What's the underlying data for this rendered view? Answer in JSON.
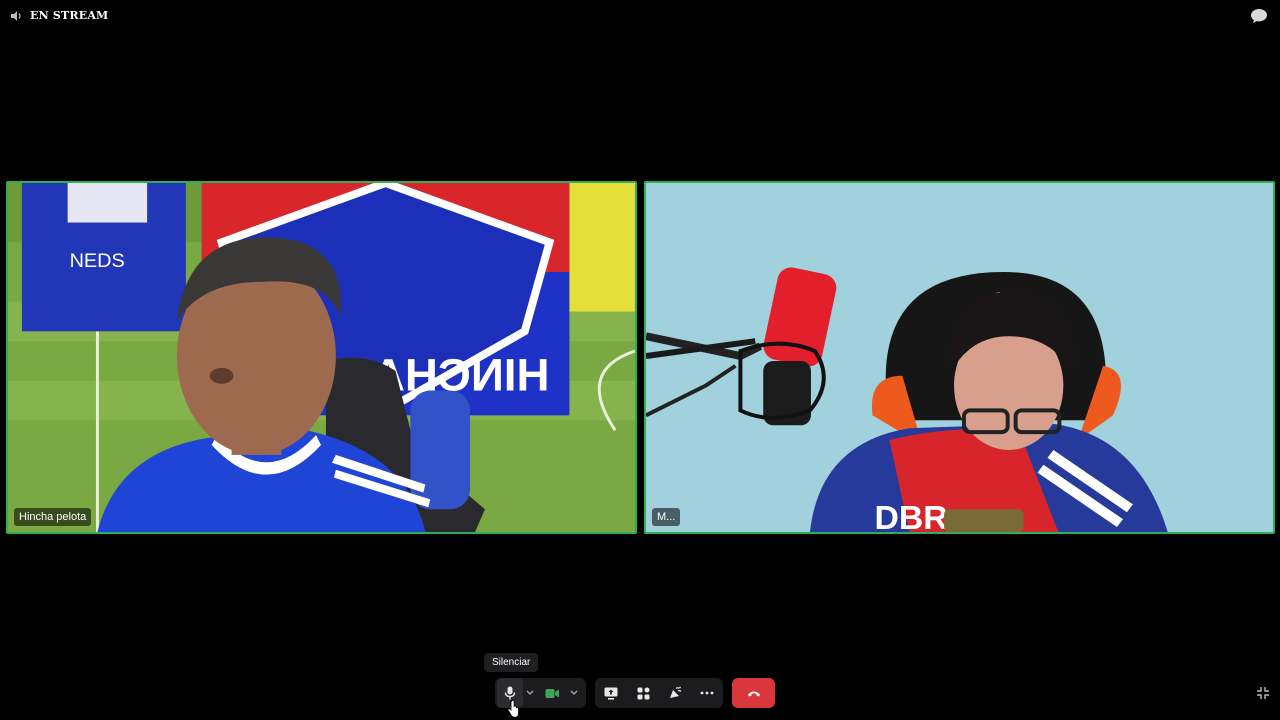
{
  "header": {
    "stream_label": "EN STREAM"
  },
  "participants": [
    {
      "name": "Hincha pelota"
    },
    {
      "name": "M..."
    }
  ],
  "controls": {
    "mute_tooltip": "Silenciar"
  },
  "colors": {
    "speaking_border": "#2fae55",
    "leave_button": "#da373c",
    "toolbar_bg": "#1c1c1f",
    "video_icon": "#3ba55d"
  },
  "icons": [
    "speaker-icon",
    "chat-icon",
    "microphone-icon",
    "chevron-down-icon",
    "video-camera-icon",
    "screen-share-icon",
    "activities-icon",
    "soundboard-icon",
    "more-icon",
    "hang-up-icon",
    "collapse-icon"
  ]
}
